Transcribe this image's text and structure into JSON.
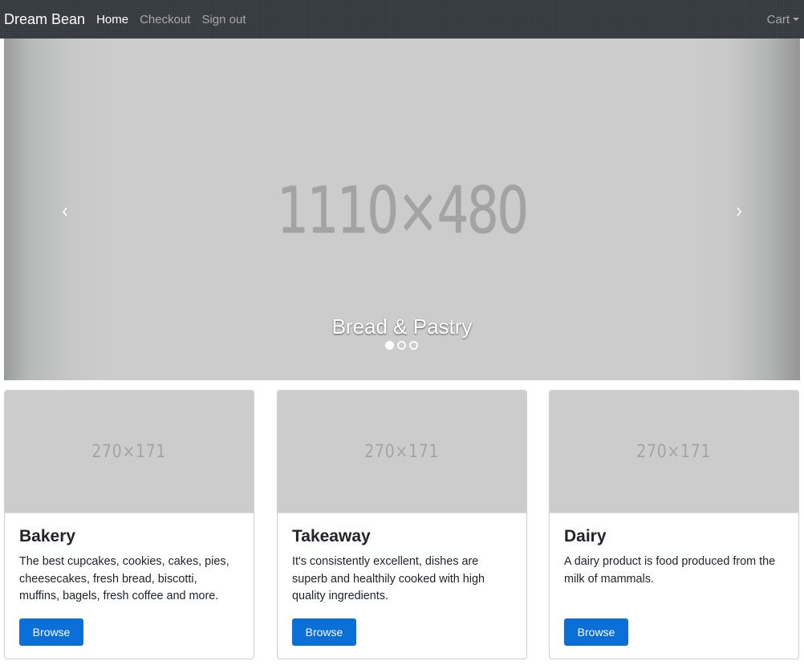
{
  "navbar": {
    "brand": "Dream Bean",
    "links": [
      {
        "label": "Home",
        "active": true
      },
      {
        "label": "Checkout",
        "active": false
      },
      {
        "label": "Sign out",
        "active": false
      }
    ],
    "cart_label": "Cart"
  },
  "carousel": {
    "placeholder_text": "1110×480",
    "caption": "Bread & Pastry",
    "slide_count": 3,
    "active_slide": 1,
    "prev_icon": "chevron-left-icon",
    "next_icon": "chevron-right-icon"
  },
  "cards": [
    {
      "placeholder": "270×171",
      "title": "Bakery",
      "text": "The best cupcakes, cookies, cakes, pies, cheesecakes, fresh bread, biscotti, muffins, bagels, fresh coffee and more.",
      "button": "Browse"
    },
    {
      "placeholder": "270×171",
      "title": "Takeaway",
      "text": "It's consistently excellent, dishes are superb and healthily cooked with high quality ingredients.",
      "button": "Browse"
    },
    {
      "placeholder": "270×171",
      "title": "Dairy",
      "text": "A dairy product is food produced from the milk of mammals.",
      "button": "Browse"
    }
  ],
  "colors": {
    "navbar_bg": "#343a40",
    "primary_button": "#0b6fd8",
    "placeholder_bg": "#cccccc"
  }
}
